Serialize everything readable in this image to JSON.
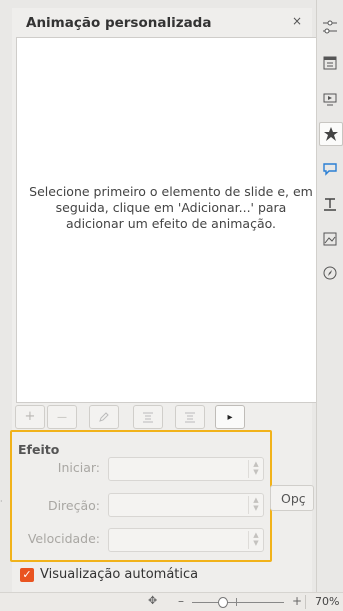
{
  "panel": {
    "title": "Animação personalizada",
    "close_glyph": "×",
    "empty_message": "Selecione primeiro o elemento de slide e, em\nseguida, clique em 'Adicionar...' para\nadicionar um efeito de animação."
  },
  "toolbar": {
    "add_glyph": "+",
    "remove_glyph": "—",
    "edit_icon": "pencil-icon",
    "move_up_icon": "move-up-icon",
    "move_down_icon": "move-down-icon",
    "play_glyph": "▸"
  },
  "effect": {
    "title": "Efeito",
    "start_label": "Iniciar:",
    "start_value": "",
    "direction_label": "Direção:",
    "direction_value": "",
    "speed_label": "Velocidade:",
    "speed_value": "",
    "options_label": "Opç"
  },
  "preview": {
    "label": "Visualização automática",
    "checked": true
  },
  "statusbar": {
    "move_glyph": "✥",
    "zoom_minus": "–",
    "zoom_plus": "+",
    "zoom_level": "70%"
  },
  "sidebar": {
    "icons": [
      "properties-icon",
      "page-layout-icon",
      "slide-transition-icon",
      "animation-star-icon",
      "master-slides-icon",
      "styles-icon",
      "gallery-icon",
      "navigator-icon"
    ]
  },
  "colors": {
    "accent_orange": "#e95420",
    "highlight_yellow": "#f1b21a"
  }
}
